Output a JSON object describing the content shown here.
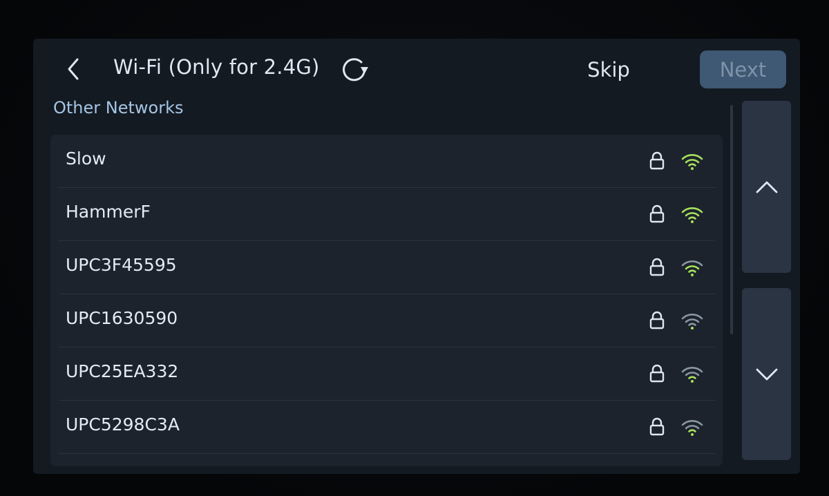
{
  "header": {
    "back_icon": "chevron-left-icon",
    "title": "Wi-Fi (Only for 2.4G)",
    "refresh_icon": "refresh-icon",
    "skip_label": "Skip",
    "next_label": "Next",
    "next_enabled": false
  },
  "section_label": "Other Networks",
  "networks": [
    {
      "ssid": "Slow",
      "secured": true,
      "signal": "strong"
    },
    {
      "ssid": "HammerF",
      "secured": true,
      "signal": "strong"
    },
    {
      "ssid": "UPC3F45595",
      "secured": true,
      "signal": "strong"
    },
    {
      "ssid": "UPC1630590",
      "secured": true,
      "signal": "weak"
    },
    {
      "ssid": "UPC25EA332",
      "secured": true,
      "signal": "medium"
    },
    {
      "ssid": "UPC5298C3A",
      "secured": true,
      "signal": "medium"
    }
  ],
  "scroll": {
    "up_icon": "chevron-up-icon",
    "down_icon": "chevron-down-icon"
  },
  "colors": {
    "background": "#141a22",
    "panel": "#1c232d",
    "accent_green": "#a8e05a",
    "dim_signal": "#8a96a3",
    "next_button": "#3f5873",
    "text": "#dfe7f2",
    "section_label": "#a6c5e3"
  }
}
